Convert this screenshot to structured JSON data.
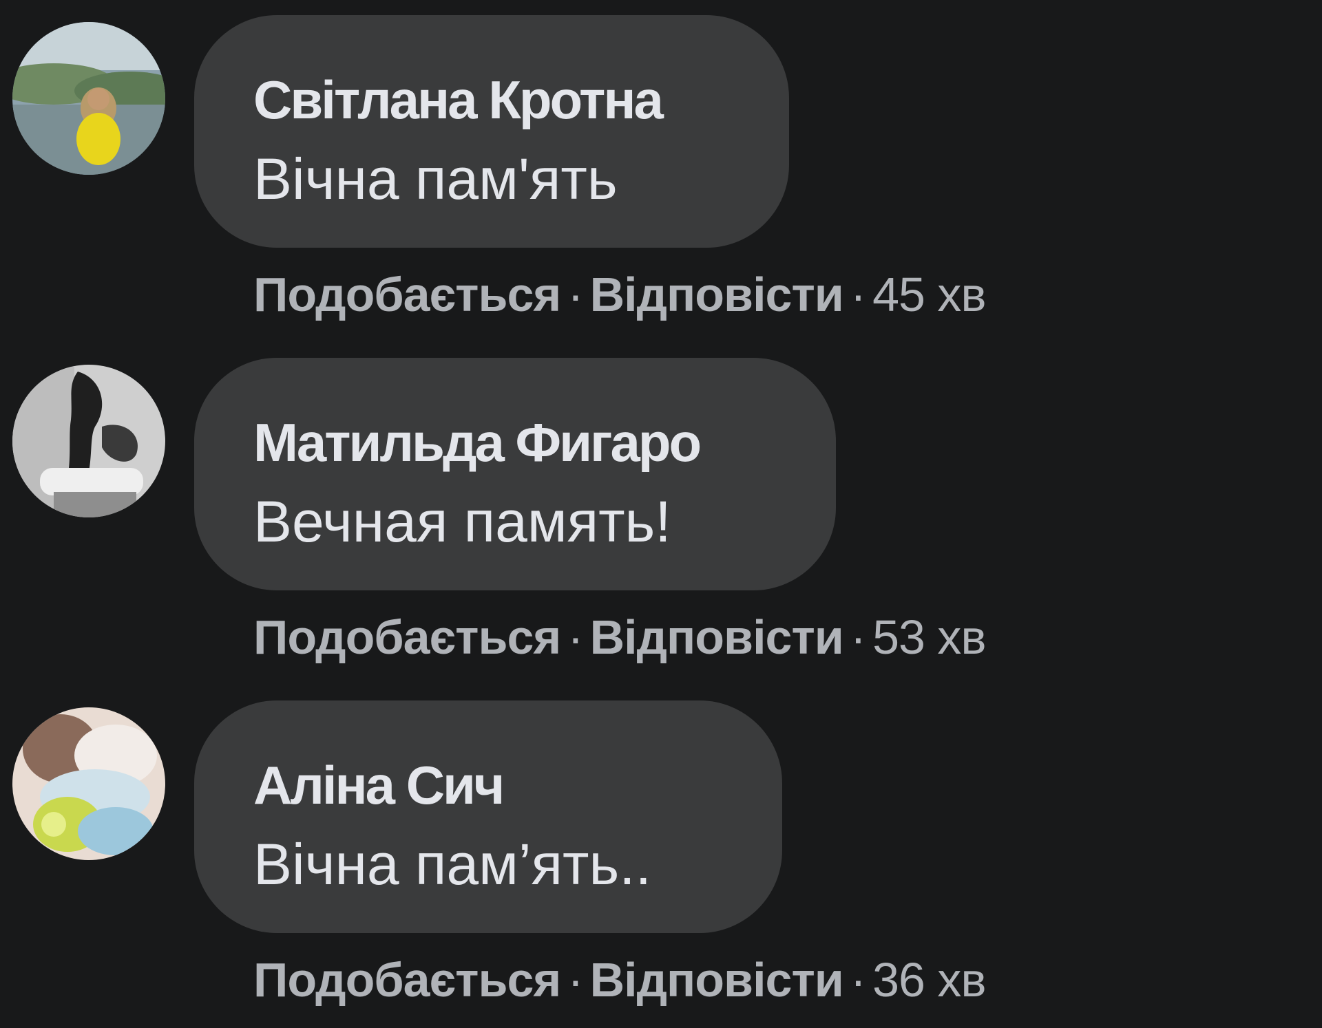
{
  "comments": [
    {
      "author": "Світлана Кротна",
      "text": "Вічна пам'ять",
      "like": "Подобається",
      "reply": "Відповісти",
      "separator": "·",
      "time": "45 хв",
      "avatar_colors": [
        "#9fb0b8",
        "#6a8a5a",
        "#e6d21a"
      ]
    },
    {
      "author": "Матильда Фигаро",
      "text": "Вечная память!",
      "like": "Подобається",
      "reply": "Відповісти",
      "separator": "·",
      "time": "53 хв",
      "avatar_colors": [
        "#d8d8d8",
        "#2a2a2a",
        "#8a8a8a"
      ]
    },
    {
      "author": "Аліна Сич",
      "text": "Вічна пам’ять..",
      "like": "Подобається",
      "reply": "Відповісти",
      "separator": "·",
      "time": "36 хв",
      "avatar_colors": [
        "#e8d6cc",
        "#9ac4d8",
        "#c8d84a"
      ]
    }
  ],
  "colors": {
    "background": "#18191a",
    "bubble": "#3a3b3c",
    "primary_text": "#e4e6eb",
    "secondary_text": "#b0b3b8"
  }
}
